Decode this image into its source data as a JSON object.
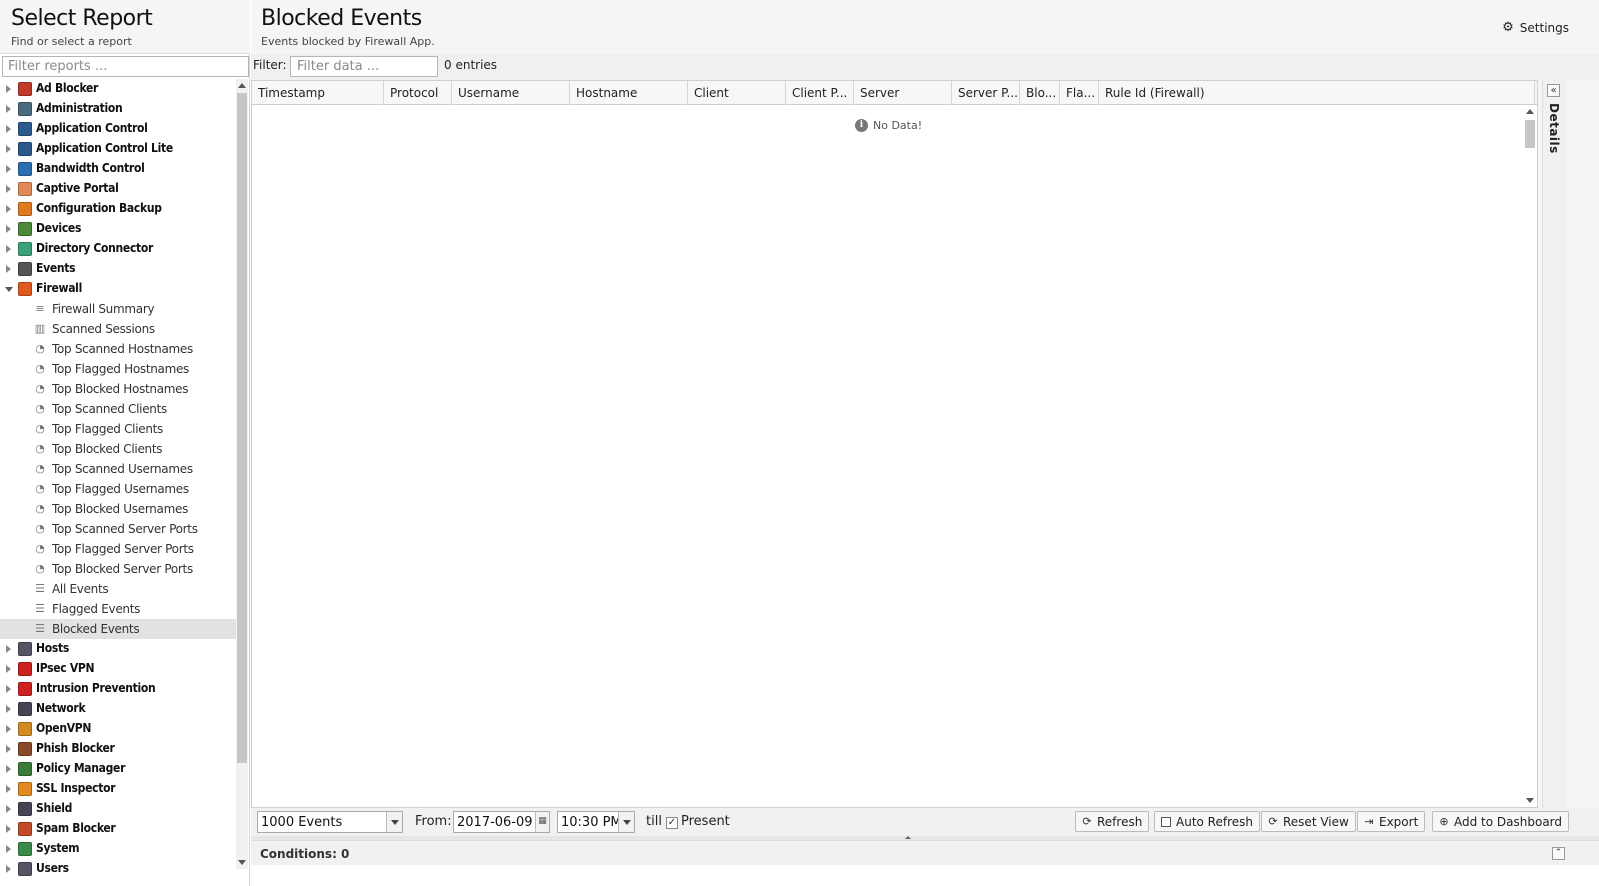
{
  "left": {
    "title": "Select Report",
    "subtitle": "Find or select a report",
    "filter_placeholder": "Filter reports ..."
  },
  "tree": [
    {
      "kind": "top",
      "label": "Ad Blocker",
      "icon": "ad-blocker-icon",
      "color": "#c0392b",
      "open": false
    },
    {
      "kind": "top",
      "label": "Administration",
      "icon": "administration-icon",
      "color": "#4a6b7d",
      "open": false
    },
    {
      "kind": "top",
      "label": "Application Control",
      "icon": "application-control-icon",
      "color": "#2c5a8a",
      "open": false
    },
    {
      "kind": "top",
      "label": "Application Control Lite",
      "icon": "application-control-lite-icon",
      "color": "#2c5a8a",
      "open": false
    },
    {
      "kind": "top",
      "label": "Bandwidth Control",
      "icon": "bandwidth-control-icon",
      "color": "#2c6fb0",
      "open": false
    },
    {
      "kind": "top",
      "label": "Captive Portal",
      "icon": "captive-portal-icon",
      "color": "#e08a5a",
      "open": false
    },
    {
      "kind": "top",
      "label": "Configuration Backup",
      "icon": "configuration-backup-icon",
      "color": "#e07a20",
      "open": false
    },
    {
      "kind": "top",
      "label": "Devices",
      "icon": "devices-icon",
      "color": "#4a8a3a",
      "open": false
    },
    {
      "kind": "top",
      "label": "Directory Connector",
      "icon": "directory-connector-icon",
      "color": "#3aa07a",
      "open": false
    },
    {
      "kind": "top",
      "label": "Events",
      "icon": "events-icon",
      "color": "#555555",
      "open": false
    },
    {
      "kind": "top",
      "label": "Firewall",
      "icon": "firewall-icon",
      "color": "#e05a20",
      "open": true
    },
    {
      "kind": "child",
      "label": "Firewall Summary",
      "icon": "text-summary-icon",
      "glyph": "≡"
    },
    {
      "kind": "child",
      "label": "Scanned Sessions",
      "icon": "bar-chart-icon",
      "glyph": "▥"
    },
    {
      "kind": "child",
      "label": "Top Scanned Hostnames",
      "icon": "pie-chart-icon",
      "glyph": "◔"
    },
    {
      "kind": "child",
      "label": "Top Flagged Hostnames",
      "icon": "pie-chart-icon",
      "glyph": "◔"
    },
    {
      "kind": "child",
      "label": "Top Blocked Hostnames",
      "icon": "pie-chart-icon",
      "glyph": "◔"
    },
    {
      "kind": "child",
      "label": "Top Scanned Clients",
      "icon": "pie-chart-icon",
      "glyph": "◔"
    },
    {
      "kind": "child",
      "label": "Top Flagged Clients",
      "icon": "pie-chart-icon",
      "glyph": "◔"
    },
    {
      "kind": "child",
      "label": "Top Blocked Clients",
      "icon": "pie-chart-icon",
      "glyph": "◔"
    },
    {
      "kind": "child",
      "label": "Top Scanned Usernames",
      "icon": "pie-chart-icon",
      "glyph": "◔"
    },
    {
      "kind": "child",
      "label": "Top Flagged Usernames",
      "icon": "pie-chart-icon",
      "glyph": "◔"
    },
    {
      "kind": "child",
      "label": "Top Blocked Usernames",
      "icon": "pie-chart-icon",
      "glyph": "◔"
    },
    {
      "kind": "child",
      "label": "Top Scanned Server Ports",
      "icon": "pie-chart-icon",
      "glyph": "◔"
    },
    {
      "kind": "child",
      "label": "Top Flagged Server Ports",
      "icon": "pie-chart-icon",
      "glyph": "◔"
    },
    {
      "kind": "child",
      "label": "Top Blocked Server Ports",
      "icon": "pie-chart-icon",
      "glyph": "◔"
    },
    {
      "kind": "child",
      "label": "All Events",
      "icon": "list-icon",
      "glyph": "☰"
    },
    {
      "kind": "child",
      "label": "Flagged Events",
      "icon": "list-icon",
      "glyph": "☰"
    },
    {
      "kind": "child",
      "label": "Blocked Events",
      "icon": "list-icon",
      "glyph": "☰",
      "selected": true
    },
    {
      "kind": "top",
      "label": "Hosts",
      "icon": "hosts-icon",
      "color": "#555566",
      "open": false
    },
    {
      "kind": "top",
      "label": "IPsec VPN",
      "icon": "ipsec-vpn-icon",
      "color": "#cc2222",
      "open": false
    },
    {
      "kind": "top",
      "label": "Intrusion Prevention",
      "icon": "intrusion-prevention-icon",
      "color": "#cc2222",
      "open": false
    },
    {
      "kind": "top",
      "label": "Network",
      "icon": "network-icon",
      "color": "#444455",
      "open": false
    },
    {
      "kind": "top",
      "label": "OpenVPN",
      "icon": "openvpn-icon",
      "color": "#d08a20",
      "open": false
    },
    {
      "kind": "top",
      "label": "Phish Blocker",
      "icon": "phish-blocker-icon",
      "color": "#8a4a2a",
      "open": false
    },
    {
      "kind": "top",
      "label": "Policy Manager",
      "icon": "policy-manager-icon",
      "color": "#3a7a3a",
      "open": false
    },
    {
      "kind": "top",
      "label": "SSL Inspector",
      "icon": "ssl-inspector-icon",
      "color": "#e08a20",
      "open": false
    },
    {
      "kind": "top",
      "label": "Shield",
      "icon": "shield-icon",
      "color": "#444455",
      "open": false
    },
    {
      "kind": "top",
      "label": "Spam Blocker",
      "icon": "spam-blocker-icon",
      "color": "#c04a2a",
      "open": false
    },
    {
      "kind": "top",
      "label": "System",
      "icon": "system-icon",
      "color": "#3a8a4a",
      "open": false
    },
    {
      "kind": "top",
      "label": "Users",
      "icon": "users-icon",
      "color": "#555566",
      "open": false
    }
  ],
  "main": {
    "title": "Blocked Events",
    "subtitle": "Events blocked by Firewall App.",
    "settings_label": "Settings",
    "filter_label": "Filter:",
    "filter_placeholder": "Filter data ...",
    "entries": "0 entries",
    "columns": [
      "Timestamp",
      "Protocol",
      "Username",
      "Hostname",
      "Client",
      "Client P...",
      "Server",
      "Server P...",
      "Blo...",
      "Fla...",
      "Rule Id (Firewall)"
    ],
    "no_data": "No Data!",
    "details_label": "Details"
  },
  "toolbar": {
    "events_value": "1000 Events",
    "from_label": "From:",
    "date_value": "2017-06-09",
    "time_value": "10:30 PM",
    "till_label": "till",
    "present_label": "Present",
    "present_checked": true,
    "buttons": {
      "refresh": "Refresh",
      "auto_refresh": "Auto Refresh",
      "reset_view": "Reset View",
      "export": "Export",
      "add_dashboard": "Add to Dashboard"
    }
  },
  "conditions": {
    "label": "Conditions: 0"
  }
}
